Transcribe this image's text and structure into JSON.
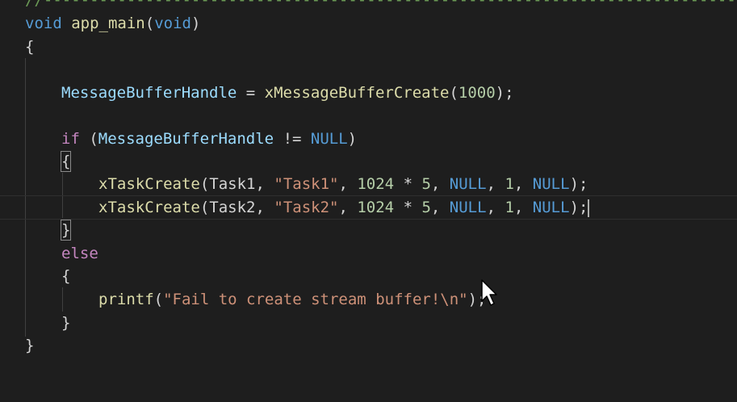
{
  "editor": {
    "divider_comment": "//---------------------------------------------------------------------------------------------",
    "line_app_main": {
      "kw1": "void",
      "fn": "app_main",
      "open": "(",
      "kw2": "void",
      "close": ")"
    },
    "brace_open": "{",
    "line_create": {
      "var": "MessageBufferHandle",
      "eq": " = ",
      "fn": "xMessageBufferCreate",
      "open": "(",
      "num": "1000",
      "close": ");"
    },
    "line_if": {
      "kw": "if",
      "open": " (",
      "var": "MessageBufferHandle",
      "op": " != ",
      "null": "NULL",
      "close": ")"
    },
    "if_brace_open": "{",
    "task1": {
      "fn": "xTaskCreate",
      "open": "(",
      "name": "Task1",
      "c1": ", ",
      "str": "\"Task1\"",
      "c2": ", ",
      "n1": "1024",
      "mul": " * ",
      "n2": "5",
      "c3": ", ",
      "null1": "NULL",
      "c4": ", ",
      "n3": "1",
      "c5": ", ",
      "null2": "NULL",
      "close": ");"
    },
    "task2": {
      "fn": "xTaskCreate",
      "open": "(",
      "name": "Task2",
      "c1": ", ",
      "str": "\"Task2\"",
      "c2": ", ",
      "n1": "1024",
      "mul": " * ",
      "n2": "5",
      "c3": ", ",
      "null1": "NULL",
      "c4": ", ",
      "n3": "1",
      "c5": ", ",
      "null2": "NULL",
      "close": ");"
    },
    "if_brace_close": "}",
    "else_kw": "else",
    "else_brace_open": "{",
    "printf": {
      "fn": "printf",
      "open": "(",
      "str": "\"Fail to create stream buffer!\\n\"",
      "close": ");"
    },
    "else_brace_close": "}",
    "brace_close": "}"
  },
  "colors": {
    "background": "#1e1e1e",
    "keyword": "#569cd6",
    "control": "#c586c0",
    "function": "#dcdcaa",
    "variable": "#9cdcfe",
    "string": "#ce9178",
    "number": "#b5cea8"
  },
  "icons": {
    "pointer": "mouse-pointer-icon"
  }
}
